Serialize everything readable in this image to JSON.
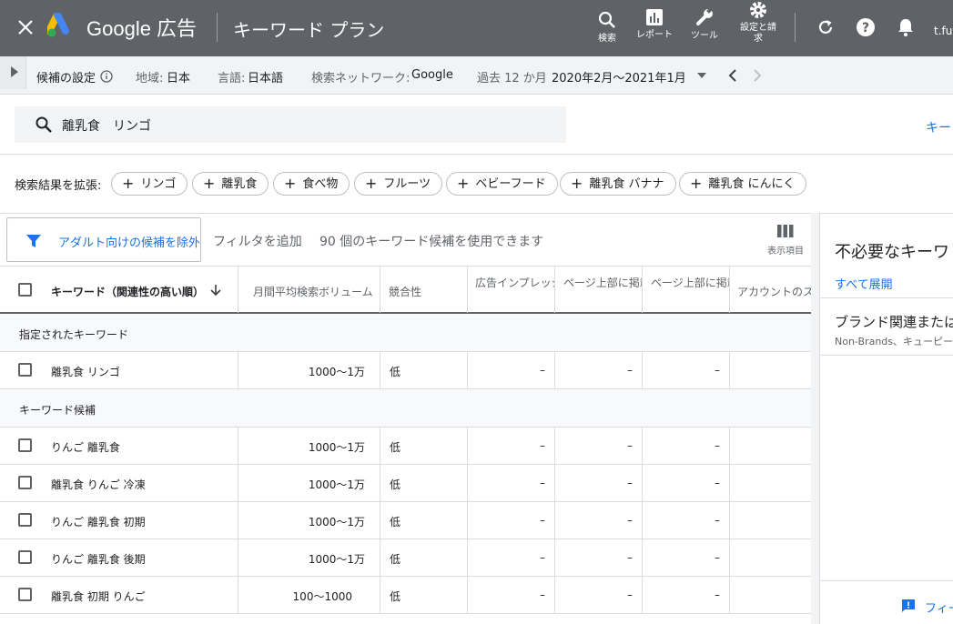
{
  "header": {
    "brand": "Google 広告",
    "title": "キーワード プラン",
    "tools": [
      {
        "label": "検索",
        "icon": "search-icon"
      },
      {
        "label": "レポート",
        "icon": "report-icon"
      },
      {
        "label": "ツール",
        "icon": "wrench-icon"
      },
      {
        "label": "設定と請求",
        "icon": "gear-icon"
      }
    ],
    "user": "t.ful"
  },
  "settings": {
    "label": "候補の設定",
    "region_label": "地域:",
    "region": "日本",
    "lang_label": "言語:",
    "lang": "日本語",
    "network_label": "検索ネットワーク:",
    "network": "Google",
    "period_label": "過去 12 か月",
    "period": "2020年2月～2021年1月"
  },
  "search": {
    "query": "離乳食　リンゴ",
    "right_link": "キー"
  },
  "expand": {
    "label": "検索結果を拡張:",
    "chips": [
      "リンゴ",
      "離乳食",
      "食べ物",
      "フルーツ",
      "ベビーフード",
      "離乳食 バナナ",
      "離乳食 にんにく"
    ]
  },
  "toolbar": {
    "filter_exclude": "アダルト向けの候補を除外",
    "add_filter": "フィルタを追加",
    "count": "90 個のキーワード候補を使用できます",
    "columns": "表示項目"
  },
  "table": {
    "headers": [
      "キーワード（関連性の高い順）",
      "月間平均検索ボリューム",
      "競合性",
      "広告インプレッション",
      "ページ上部に掲載",
      "ページ上部に掲載",
      "アカウントのステータス"
    ],
    "group_specified": "指定されたキーワード",
    "specified_rows": [
      {
        "keyword": "離乳食 リンゴ",
        "volume": "1000～1万",
        "competition": "低",
        "c4": "–",
        "c5": "–",
        "c6": "–"
      }
    ],
    "group_ideas": "キーワード候補",
    "idea_rows": [
      {
        "keyword": "りんご 離乳食",
        "volume": "1000～1万",
        "competition": "低",
        "c4": "–",
        "c5": "–",
        "c6": "–"
      },
      {
        "keyword": "離乳食 りんご 冷凍",
        "volume": "1000～1万",
        "competition": "低",
        "c4": "–",
        "c5": "–",
        "c6": "–"
      },
      {
        "keyword": "りんご 離乳食 初期",
        "volume": "1000～1万",
        "competition": "低",
        "c4": "–",
        "c5": "–",
        "c6": "–"
      },
      {
        "keyword": "りんご 離乳食 後期",
        "volume": "1000～1万",
        "competition": "低",
        "c4": "–",
        "c5": "–",
        "c6": "–"
      },
      {
        "keyword": "離乳食 初期 りんご",
        "volume": "100～1000",
        "competition": "低",
        "c4": "–",
        "c5": "–",
        "c6": "–"
      }
    ]
  },
  "panel": {
    "title": "不必要なキーワ",
    "expand_all": "すべて展開",
    "section": "ブランド関連または",
    "section_sub": "Non-Brands、キューピー",
    "feedback": "フィー"
  }
}
